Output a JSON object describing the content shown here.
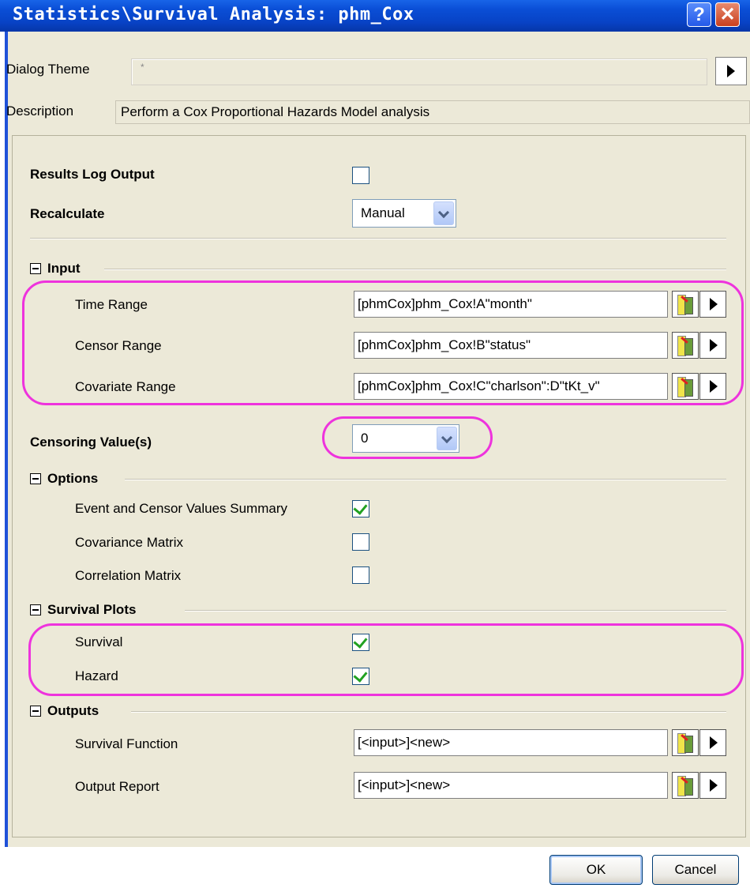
{
  "window": {
    "title": "Statistics\\Survival Analysis: phm_Cox",
    "help": "?",
    "close": "✕"
  },
  "theme": {
    "label": "Dialog Theme",
    "value": "*"
  },
  "description": {
    "label": "Description",
    "value": "Perform a Cox Proportional Hazards Model analysis"
  },
  "results_log": {
    "label": "Results Log Output",
    "checked": false
  },
  "recalculate": {
    "label": "Recalculate",
    "value": "Manual"
  },
  "input": {
    "header": "Input",
    "rows": [
      {
        "label": "Time Range",
        "value": "[phmCox]phm_Cox!A\"month\""
      },
      {
        "label": "Censor Range",
        "value": "[phmCox]phm_Cox!B\"status\""
      },
      {
        "label": "Covariate Range",
        "value": "[phmCox]phm_Cox!C\"charlson\":D\"tKt_v\""
      }
    ]
  },
  "censoring": {
    "label": "Censoring Value(s)",
    "value": "0"
  },
  "options": {
    "header": "Options",
    "rows": [
      {
        "label": "Event and Censor Values Summary",
        "checked": true
      },
      {
        "label": "Covariance Matrix",
        "checked": false
      },
      {
        "label": "Correlation Matrix",
        "checked": false
      }
    ]
  },
  "plots": {
    "header": "Survival Plots",
    "rows": [
      {
        "label": "Survival",
        "checked": true
      },
      {
        "label": "Hazard",
        "checked": true
      }
    ]
  },
  "outputs": {
    "header": "Outputs",
    "rows": [
      {
        "label": "Survival Function",
        "value": "[<input>]<new>"
      },
      {
        "label": "Output Report",
        "value": "[<input>]<new>"
      }
    ]
  },
  "buttons": {
    "ok": "OK",
    "cancel": "Cancel"
  },
  "colors": {
    "title_bar": "#0a4ed6",
    "highlight": "#ee33dd",
    "check": "#21a121"
  }
}
